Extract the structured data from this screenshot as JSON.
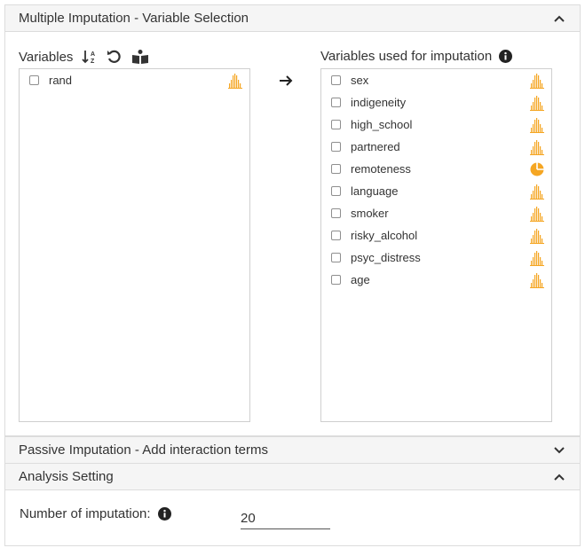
{
  "sections": {
    "mi": {
      "title": "Multiple Imputation - Variable Selection",
      "expanded": true
    },
    "passive": {
      "title": "Passive Imputation - Add interaction terms",
      "expanded": false
    },
    "analysis": {
      "title": "Analysis Setting",
      "expanded": true
    }
  },
  "variables": {
    "label": "Variables",
    "items": [
      {
        "name": "rand",
        "type": "continuous"
      }
    ]
  },
  "imputation_vars": {
    "label": "Variables used for imputation",
    "items": [
      {
        "name": "sex",
        "type": "continuous"
      },
      {
        "name": "indigeneity",
        "type": "continuous"
      },
      {
        "name": "high_school",
        "type": "continuous"
      },
      {
        "name": "partnered",
        "type": "continuous"
      },
      {
        "name": "remoteness",
        "type": "nominal"
      },
      {
        "name": "language",
        "type": "continuous"
      },
      {
        "name": "smoker",
        "type": "continuous"
      },
      {
        "name": "risky_alcohol",
        "type": "continuous"
      },
      {
        "name": "psyc_distress",
        "type": "continuous"
      },
      {
        "name": "age",
        "type": "continuous"
      }
    ]
  },
  "analysis": {
    "num_imputation_label": "Number of imputation:",
    "num_imputation_value": "20"
  },
  "colors": {
    "accent": "#f5a623",
    "border": "#dcdcdc",
    "header_bg": "#f5f5f5"
  }
}
